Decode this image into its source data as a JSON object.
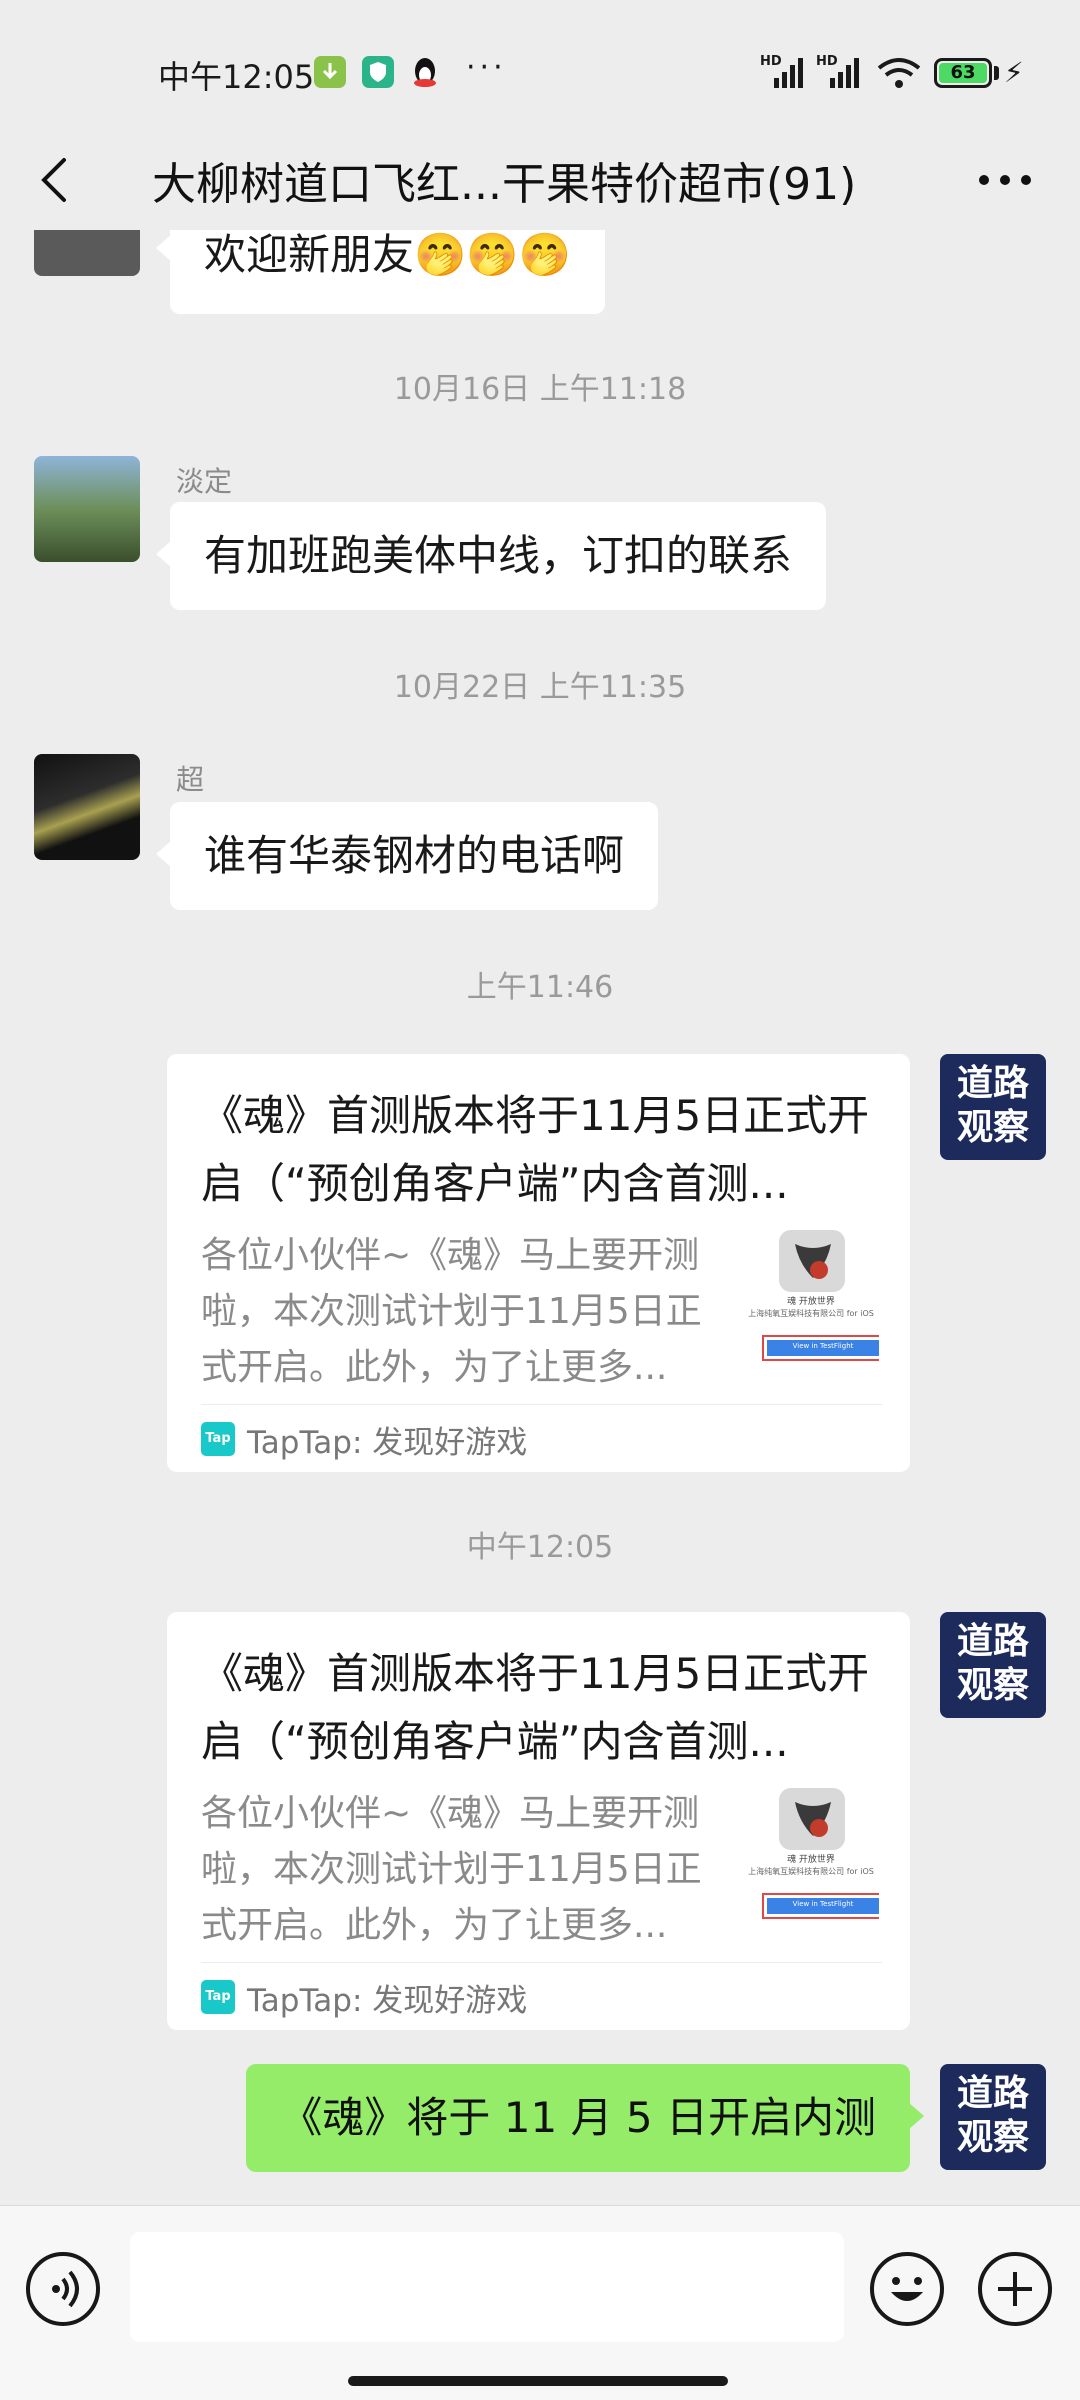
{
  "status_bar": {
    "time": "中午12:05",
    "battery": "63",
    "network_1": "HD",
    "network_2": "HD"
  },
  "header": {
    "title": "大柳树道口飞红...干果特价超市(91)"
  },
  "messages": {
    "m0": {
      "text": "欢迎新朋友🤭🤭🤭"
    },
    "ts1": "10月16日 上午11:18",
    "m1": {
      "sender": "淡定",
      "text": "有加班跑美体中线，订扣的联系"
    },
    "ts2": "10月22日 上午11:35",
    "m2": {
      "sender": "超",
      "text": "谁有华泰钢材的电话啊"
    },
    "ts3": "上午11:46",
    "card1": {
      "title": "《魂》首测版本将于11月5日正式开启（“预创角客户端”内含首测...",
      "desc": "各位小伙伴~《魂》马上要开测啦，本次测试计划于11月5日正式开启。此外，为了让更多...",
      "source": "TapTap: 发现好游戏",
      "thumb_name": "魂 开放世界",
      "thumb_company": "上海纯氧互娱科技有限公司 for iOS",
      "thumb_button": "View in TestFlight"
    },
    "ts4": "中午12:05",
    "card2": {
      "title": "《魂》首测版本将于11月5日正式开启（“预创角客户端”内含首测...",
      "desc": "各位小伙伴~《魂》马上要开测啦，本次测试计划于11月5日正式开启。此外，为了让更多...",
      "source": "TapTap: 发现好游戏",
      "thumb_name": "魂 开放世界",
      "thumb_company": "上海纯氧互娱科技有限公司 for iOS",
      "thumb_button": "View in TestFlight"
    },
    "m3": {
      "text": "《魂》将于 11 月 5 日开启内测"
    }
  },
  "avatar_daolu": {
    "line1": "道路",
    "line2": "观察"
  },
  "tap_logo": "Tap",
  "colors": {
    "background": "#ededed",
    "my_bubble": "#95ec69",
    "daolu_avatar": "#1d2a5c",
    "tap_logo": "#19c8c8"
  }
}
